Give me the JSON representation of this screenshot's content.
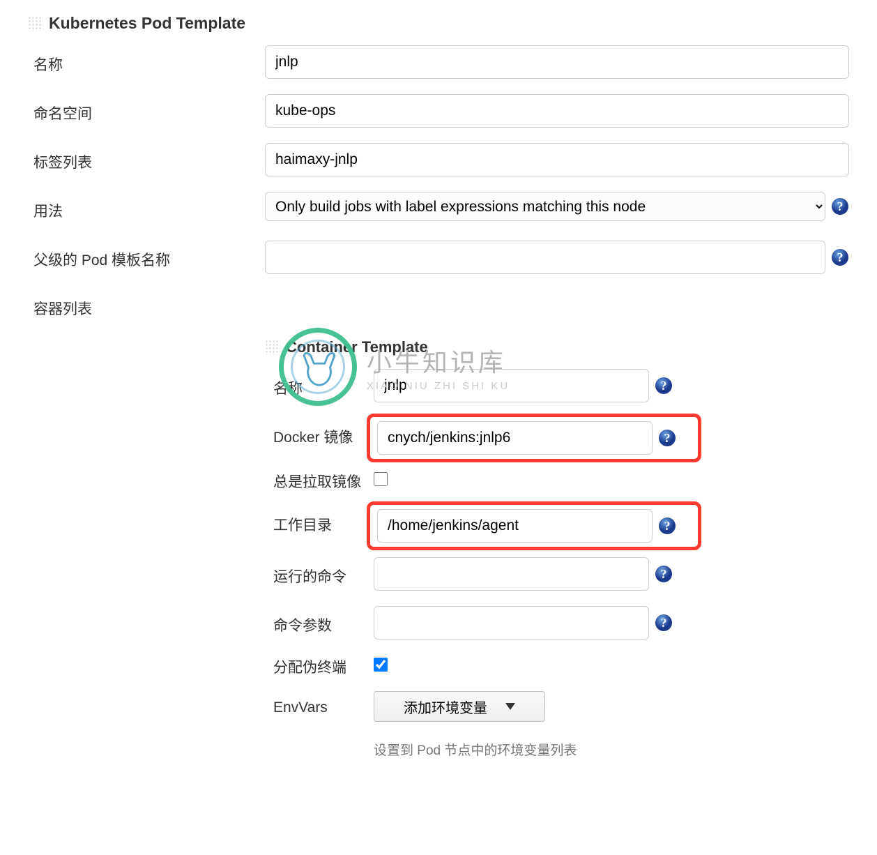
{
  "pod": {
    "section_title": "Kubernetes Pod Template",
    "name_label": "名称",
    "name_value": "jnlp",
    "namespace_label": "命名空间",
    "namespace_value": "kube-ops",
    "labels_label": "标签列表",
    "labels_value": "haimaxy-jnlp",
    "usage_label": "用法",
    "usage_value": "Only build jobs with label expressions matching this node",
    "parent_label": "父级的 Pod 模板名称",
    "parent_value": "",
    "containers_label": "容器列表"
  },
  "container": {
    "section_title": "Container Template",
    "name_label": "名称",
    "name_value": "jnlp",
    "image_label": "Docker 镜像",
    "image_value": "cnych/jenkins:jnlp6",
    "always_pull_label": "总是拉取镜像",
    "always_pull_checked": false,
    "workdir_label": "工作目录",
    "workdir_value": "/home/jenkins/agent",
    "command_label": "运行的命令",
    "command_value": "",
    "args_label": "命令参数",
    "args_value": "",
    "tty_label": "分配伪终端",
    "tty_checked": true,
    "envvars_label": "EnvVars",
    "envvars_button": "添加环境变量",
    "envvars_hint": "设置到 Pod 节点中的环境变量列表"
  },
  "watermark": {
    "cn": "小牛知识库",
    "en": "XIAO NIU ZHI SHI KU"
  }
}
